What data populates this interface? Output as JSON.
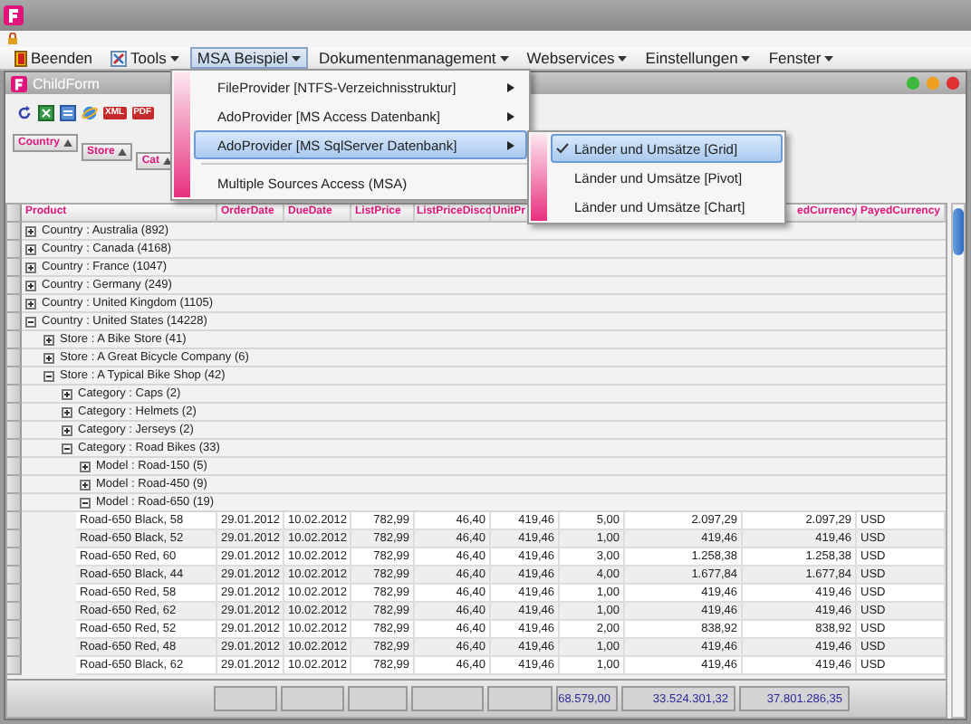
{
  "menubar": [
    {
      "label": "Beenden",
      "kind": "exit",
      "dropdown": false,
      "selected": false
    },
    {
      "label": "Tools",
      "kind": "tools",
      "dropdown": true,
      "selected": false
    },
    {
      "label": "MSA Beispiel",
      "kind": "plain",
      "dropdown": true,
      "selected": true
    },
    {
      "label": "Dokumentenmanagement",
      "kind": "plain",
      "dropdown": true,
      "selected": false
    },
    {
      "label": "Webservices",
      "kind": "plain",
      "dropdown": true,
      "selected": false
    },
    {
      "label": "Einstellungen",
      "kind": "plain",
      "dropdown": true,
      "selected": false
    },
    {
      "label": "Fenster",
      "kind": "plain",
      "dropdown": true,
      "selected": false
    }
  ],
  "menu": [
    {
      "label": "FileProvider [NTFS-Verzeichnisstruktur]",
      "submenu": true,
      "selected": false,
      "separator_before": false
    },
    {
      "label": "AdoProvider [MS Access Datenbank]",
      "submenu": true,
      "selected": false,
      "separator_before": false
    },
    {
      "label": "AdoProvider [MS SqlServer Datenbank]",
      "submenu": true,
      "selected": true,
      "separator_before": false
    },
    {
      "label": "Multiple Sources Access (MSA)",
      "submenu": false,
      "selected": false,
      "separator_before": true
    }
  ],
  "submenu": [
    {
      "label": "Länder und Umsätze [Grid]",
      "checked": true,
      "selected": true
    },
    {
      "label": "Länder und Umsätze [Pivot]",
      "checked": false,
      "selected": false
    },
    {
      "label": "Länder und Umsätze [Chart]",
      "checked": false,
      "selected": false
    }
  ],
  "child_window": {
    "title": "ChildForm"
  },
  "toolbar": [
    {
      "kind": "refresh"
    },
    {
      "kind": "excel"
    },
    {
      "kind": "word"
    },
    {
      "kind": "web"
    },
    {
      "kind": "badge",
      "label": "XML"
    },
    {
      "kind": "badge",
      "label": "PDF"
    }
  ],
  "group_chips": [
    "Country",
    "Store",
    "Cat"
  ],
  "columns": [
    "Product",
    "OrderDate",
    "DueDate",
    "ListPrice",
    "ListPriceDisco",
    "UnitPr",
    null,
    null,
    "edCurrency",
    "PayedCurrency"
  ],
  "rows": [
    {
      "label": "Country : Australia (892)",
      "expanded": false
    },
    {
      "label": "Country : Canada (4168)",
      "expanded": false
    },
    {
      "label": "Country : France (1047)",
      "expanded": false
    },
    {
      "label": "Country : Germany (249)",
      "expanded": false
    },
    {
      "label": "Country : United Kingdom (1105)",
      "expanded": false
    },
    {
      "label": "Country : United States (14228)",
      "expanded": true,
      "children": [
        {
          "label": "Store : A Bike Store (41)",
          "expanded": false
        },
        {
          "label": "Store : A Great Bicycle Company (6)",
          "expanded": false
        },
        {
          "label": "Store : A Typical Bike Shop (42)",
          "expanded": true,
          "children": [
            {
              "label": "Category : Caps (2)",
              "expanded": false
            },
            {
              "label": "Category : Helmets (2)",
              "expanded": false
            },
            {
              "label": "Category : Jerseys (2)",
              "expanded": false
            },
            {
              "label": "Category : Road Bikes (33)",
              "expanded": true,
              "children": [
                {
                  "label": "Model : Road-150 (5)",
                  "expanded": false
                },
                {
                  "label": "Model : Road-450 (9)",
                  "expanded": false
                },
                {
                  "label": "Model : Road-650 (19)",
                  "expanded": true,
                  "records": [
                    [
                      "Road-650 Black, 58",
                      "29.01.2012",
                      "10.02.2012",
                      "782,99",
                      "46,40",
                      "419,46",
                      "5,00",
                      "2.097,29",
                      "2.097,29",
                      "USD"
                    ],
                    [
                      "Road-650 Black, 52",
                      "29.01.2012",
                      "10.02.2012",
                      "782,99",
                      "46,40",
                      "419,46",
                      "1,00",
                      "419,46",
                      "419,46",
                      "USD"
                    ],
                    [
                      "Road-650 Red, 60",
                      "29.01.2012",
                      "10.02.2012",
                      "782,99",
                      "46,40",
                      "419,46",
                      "3,00",
                      "1.258,38",
                      "1.258,38",
                      "USD"
                    ],
                    [
                      "Road-650 Black, 44",
                      "29.01.2012",
                      "10.02.2012",
                      "782,99",
                      "46,40",
                      "419,46",
                      "4,00",
                      "1.677,84",
                      "1.677,84",
                      "USD"
                    ],
                    [
                      "Road-650 Red, 58",
                      "29.01.2012",
                      "10.02.2012",
                      "782,99",
                      "46,40",
                      "419,46",
                      "1,00",
                      "419,46",
                      "419,46",
                      "USD"
                    ],
                    [
                      "Road-650 Red, 62",
                      "29.01.2012",
                      "10.02.2012",
                      "782,99",
                      "46,40",
                      "419,46",
                      "1,00",
                      "419,46",
                      "419,46",
                      "USD"
                    ],
                    [
                      "Road-650 Red, 52",
                      "29.01.2012",
                      "10.02.2012",
                      "782,99",
                      "46,40",
                      "419,46",
                      "2,00",
                      "838,92",
                      "838,92",
                      "USD"
                    ],
                    [
                      "Road-650 Red, 48",
                      "29.01.2012",
                      "10.02.2012",
                      "782,99",
                      "46,40",
                      "419,46",
                      "1,00",
                      "419,46",
                      "419,46",
                      "USD"
                    ],
                    [
                      "Road-650 Black, 62",
                      "29.01.2012",
                      "10.02.2012",
                      "782,99",
                      "46,40",
                      "419,46",
                      "1,00",
                      "419,46",
                      "419,46",
                      "USD"
                    ]
                  ]
                }
              ]
            }
          ]
        }
      ]
    }
  ],
  "totals": [
    "68.579,00",
    "33.524.301,32",
    "37.801.286,35"
  ]
}
